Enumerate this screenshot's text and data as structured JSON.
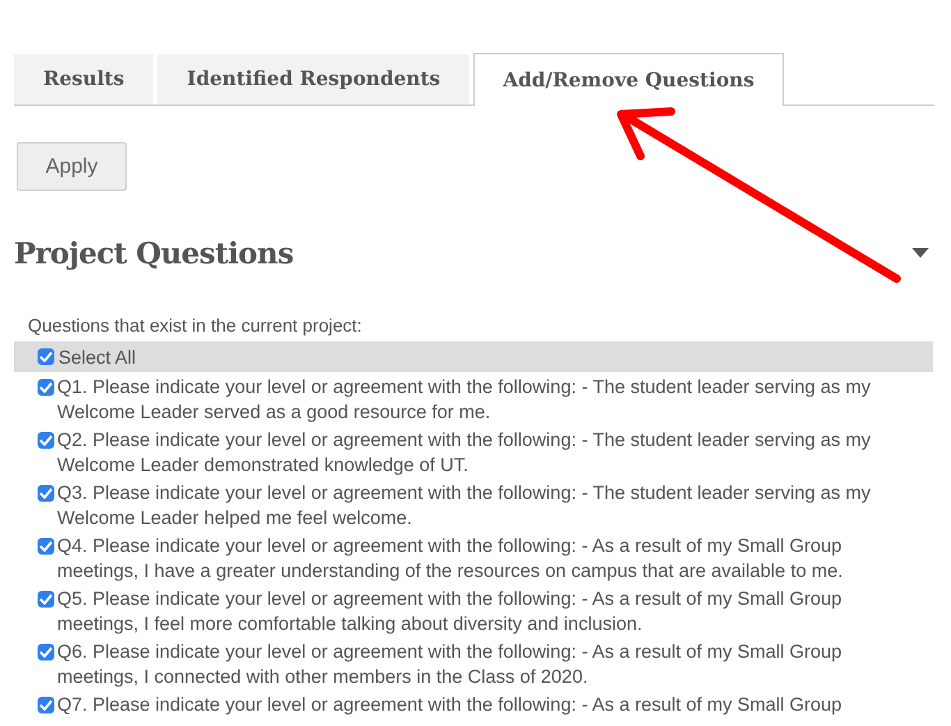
{
  "tabs": [
    {
      "label": "Results",
      "selected": false
    },
    {
      "label": "Identified Respondents",
      "selected": false
    },
    {
      "label": "Add/Remove Questions",
      "selected": true
    }
  ],
  "apply_button": "Apply",
  "section": {
    "title": "Project Questions",
    "expanded": true
  },
  "questions_label": "Questions that exist in the current project:",
  "select_all": {
    "label": "Select All",
    "checked": true
  },
  "questions": [
    {
      "text": "Q1. Please indicate your level or agreement with the following: - The student leader serving as my Welcome Leader served as a good resource for me.",
      "checked": true
    },
    {
      "text": "Q2. Please indicate your level or agreement with the following: - The student leader serving as my Welcome Leader demonstrated knowledge of UT.",
      "checked": true
    },
    {
      "text": "Q3. Please indicate your level or agreement with the following: - The student leader serving as my Welcome Leader helped me feel welcome.",
      "checked": true
    },
    {
      "text": "Q4. Please indicate your level or agreement with the following: - As a result of my Small Group meetings, I have a greater understanding of the resources on campus that are available to me.",
      "checked": true
    },
    {
      "text": "Q5. Please indicate your level or agreement with the following: - As a result of my Small Group meetings, I feel more comfortable talking about diversity and inclusion.",
      "checked": true
    },
    {
      "text": "Q6. Please indicate your level or agreement with the following: - As a result of my Small Group meetings, I connected with other members in the Class of 2020.",
      "checked": true
    },
    {
      "text": "Q7. Please indicate your level or agreement with the following: - As a result of my Small Group",
      "checked": true
    }
  ]
}
